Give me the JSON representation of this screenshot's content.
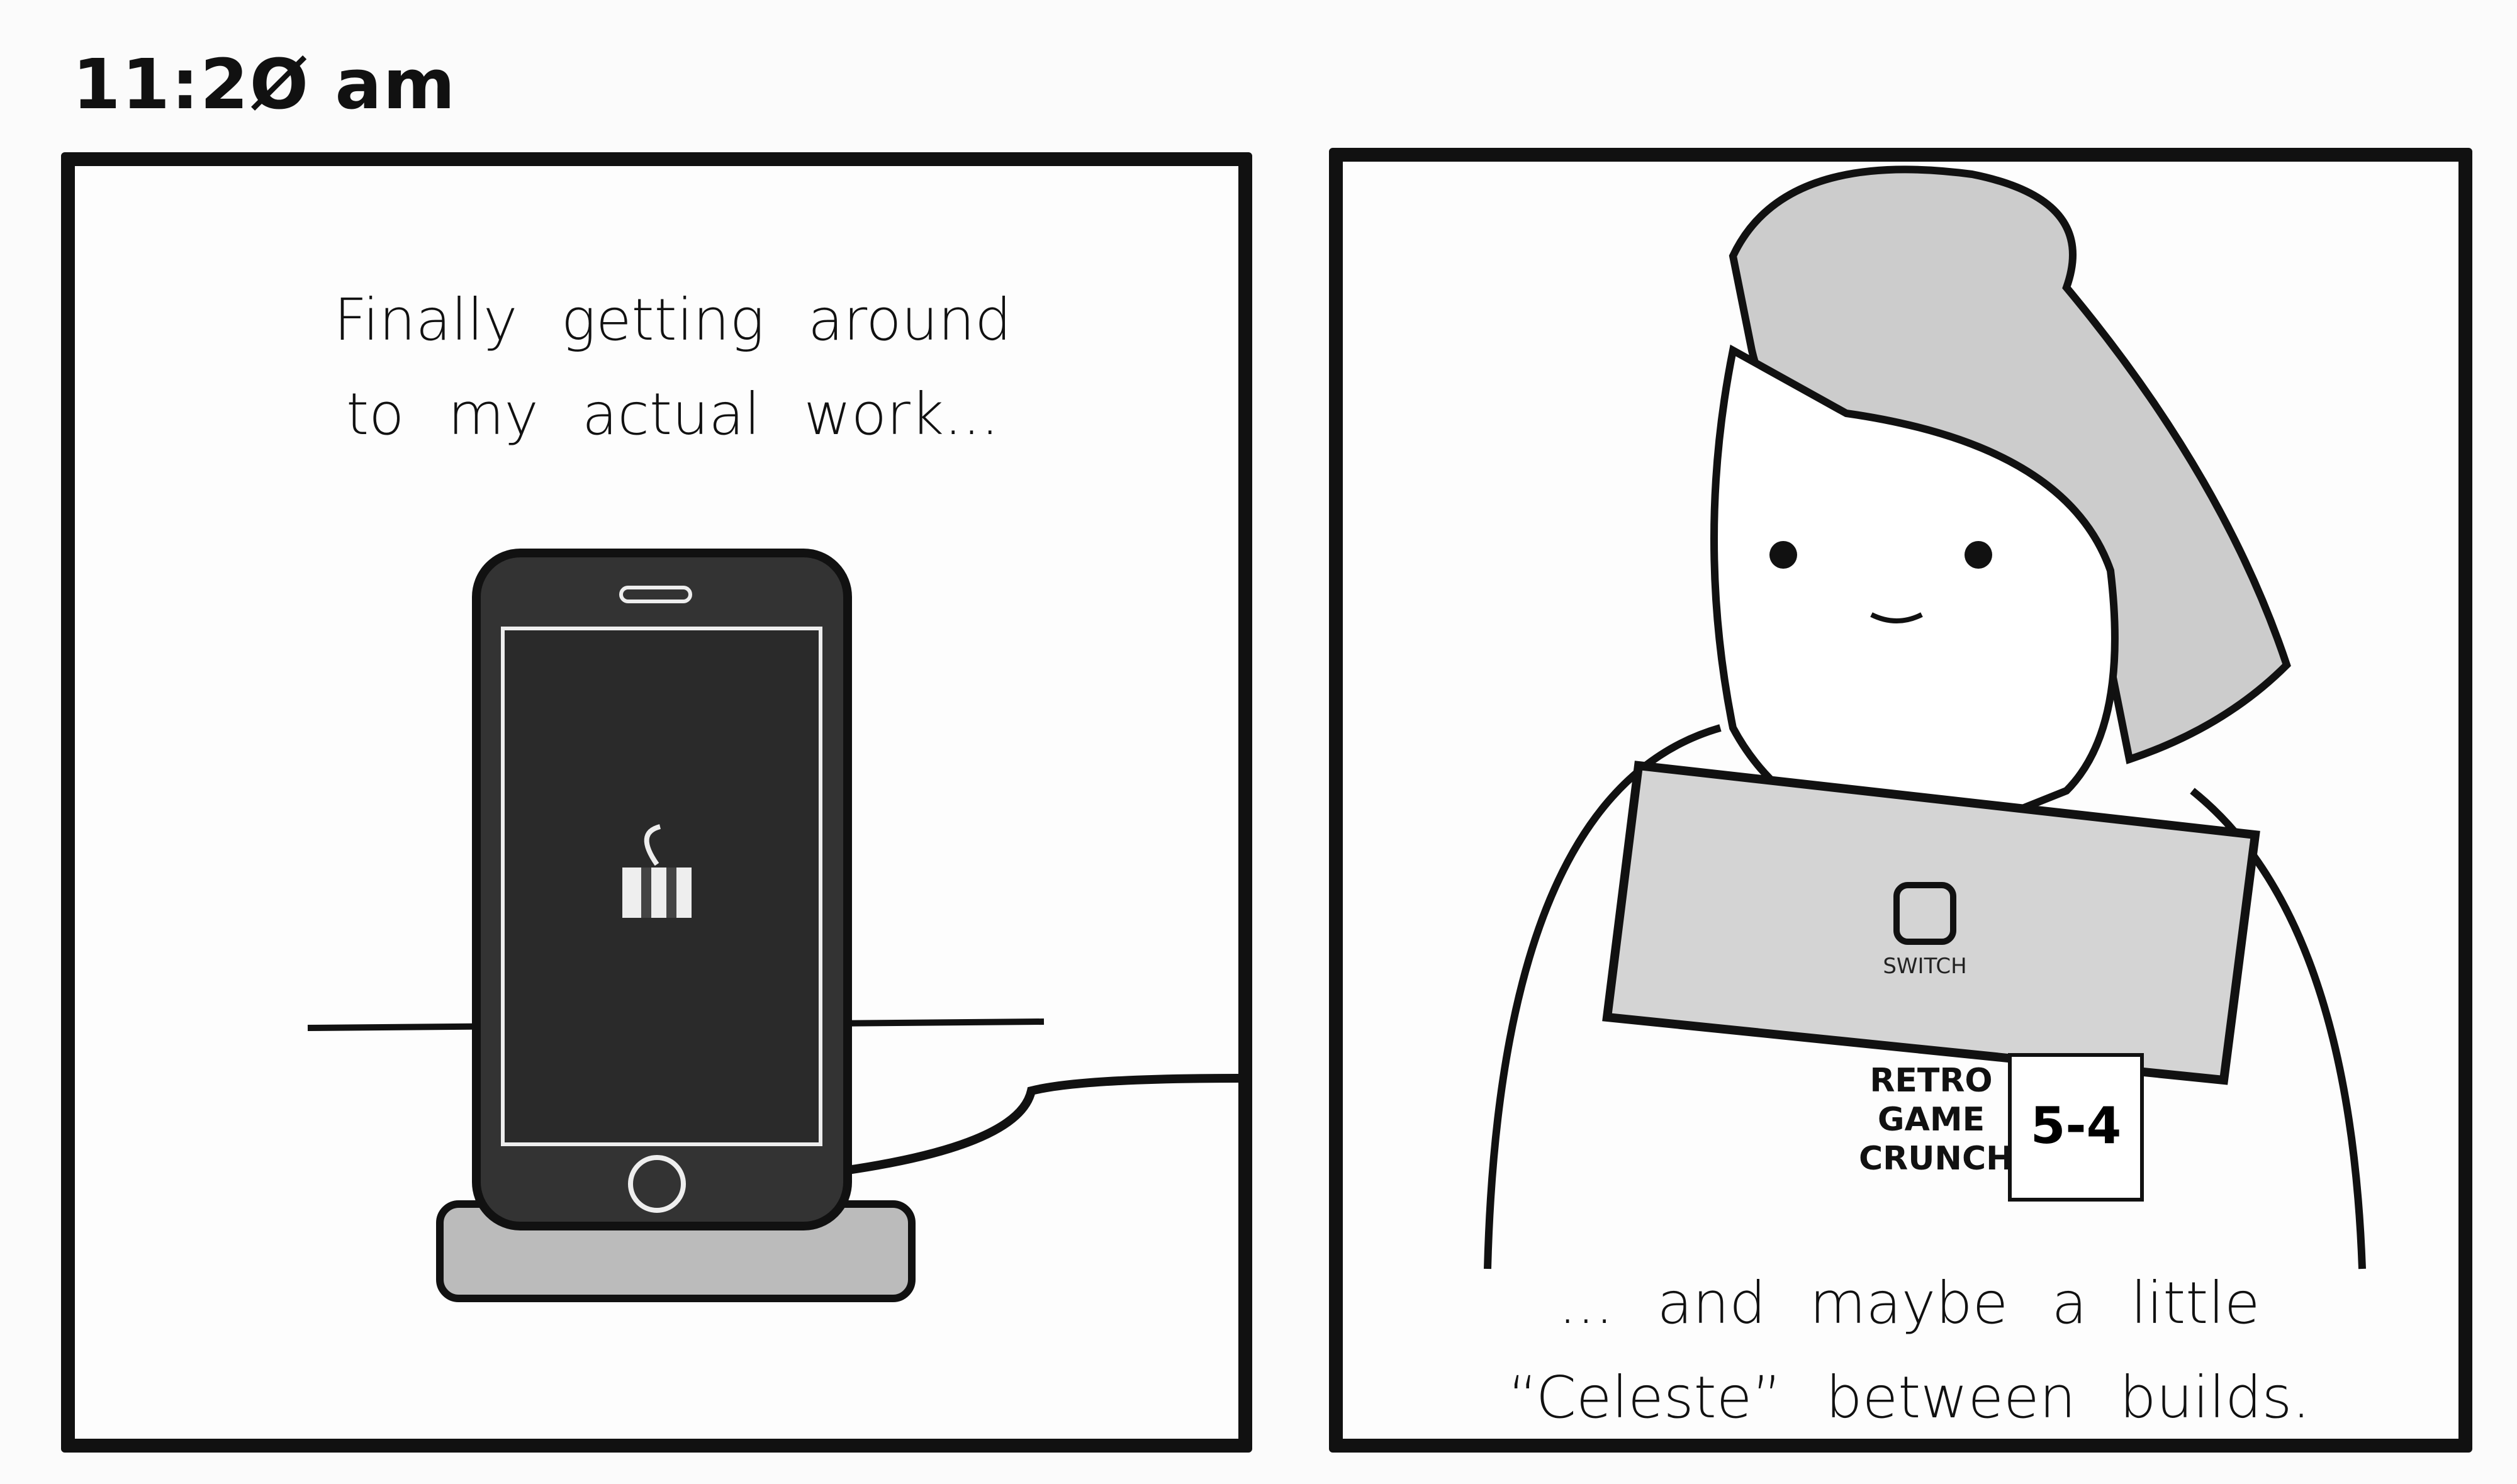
{
  "time_label": "11:2Ø am",
  "panels": [
    {
      "caption_line1": "Finally getting around",
      "caption_line2": "to my actual work...",
      "phone_icon": "gift-icon"
    },
    {
      "caption_line1": "... and maybe a little",
      "caption_line2": "“Celeste” between builds.",
      "console_label": "SWITCH",
      "shirt_text": [
        "RETRO",
        "GAME",
        "CRUNCH"
      ],
      "badge_text": "5-4"
    }
  ]
}
